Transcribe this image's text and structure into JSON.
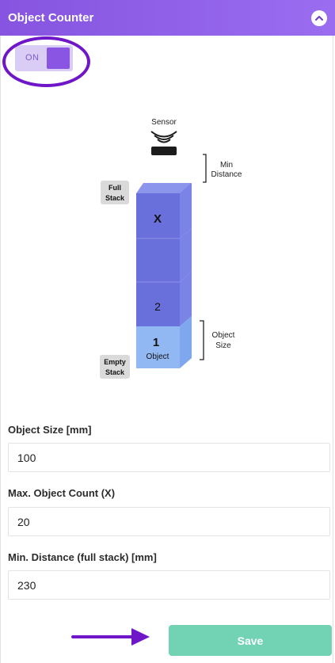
{
  "header": {
    "title": "Object Counter"
  },
  "toggle": {
    "label": "ON"
  },
  "diagram": {
    "sensor_label": "Sensor",
    "min_distance_label_1": "Min",
    "min_distance_label_2": "Distance",
    "full_stack_label_1": "Full",
    "full_stack_label_2": "Stack",
    "empty_stack_label_1": "Empty",
    "empty_stack_label_2": "Stack",
    "object_size_label_1": "Object",
    "object_size_label_2": "Size",
    "box_x": "X",
    "box_2": "2",
    "box_1": "1",
    "box_1_caption": "Object"
  },
  "fields": {
    "object_size": {
      "label": "Object Size [mm]",
      "value": "100"
    },
    "max_count": {
      "label": "Max. Object Count (X)",
      "value": "20"
    },
    "min_distance": {
      "label": "Min. Distance (full stack) [mm]",
      "value": "230"
    }
  },
  "save_label": "Save",
  "colors": {
    "header": "#8654e0",
    "toggle_knob": "#8a55e3",
    "save": "#72d3b4",
    "arrow": "#6f17c8"
  }
}
